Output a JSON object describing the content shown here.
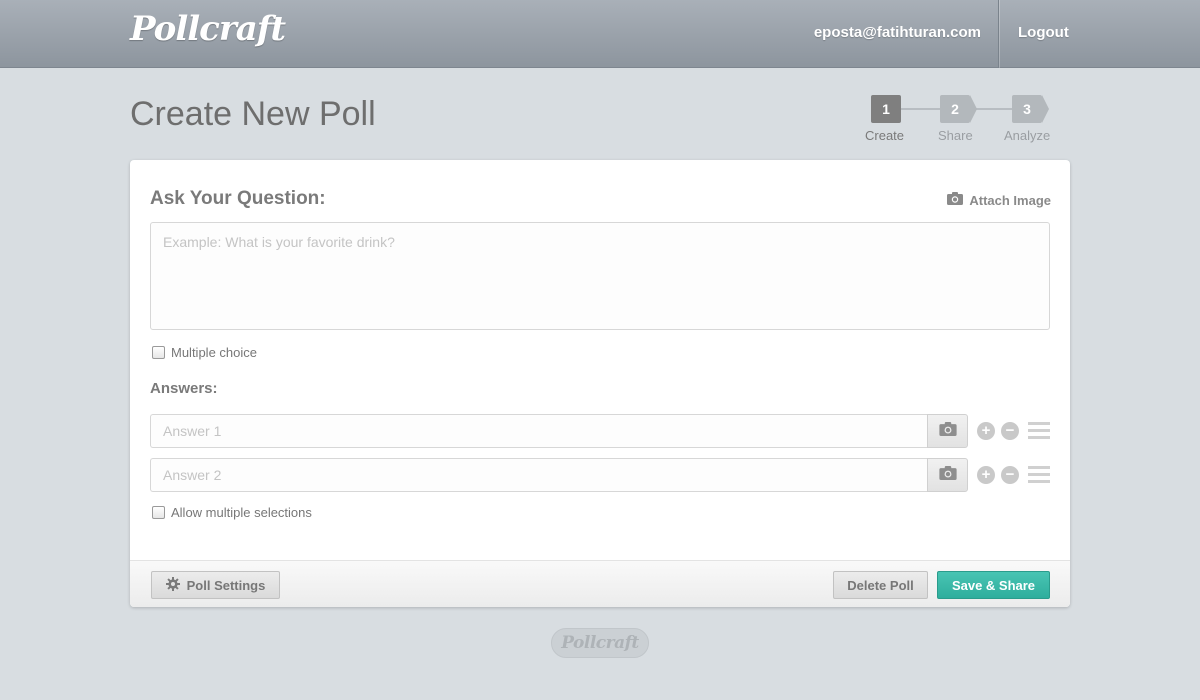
{
  "header": {
    "logo": "Pollcraft",
    "user_email": "eposta@fatihturan.com",
    "logout_label": "Logout"
  },
  "page_title": "Create New Poll",
  "steps": [
    {
      "number": "1",
      "label": "Create",
      "active": true
    },
    {
      "number": "2",
      "label": "Share",
      "active": false
    },
    {
      "number": "3",
      "label": "Analyze",
      "active": false
    }
  ],
  "form": {
    "question_label": "Ask Your Question:",
    "attach_image_label": "Attach Image",
    "question_placeholder": "Example: What is your favorite drink?",
    "multiple_choice_label": "Multiple choice",
    "answers_label": "Answers:",
    "answers": [
      {
        "placeholder": "Answer 1"
      },
      {
        "placeholder": "Answer 2"
      }
    ],
    "add_symbol": "+",
    "remove_symbol": "−",
    "allow_multiple_label": "Allow multiple selections"
  },
  "footer": {
    "poll_settings_label": "Poll Settings",
    "delete_label": "Delete Poll",
    "save_label": "Save & Share"
  },
  "bottom_logo": "Pollcraft",
  "colors": {
    "accent": "#37b5a4",
    "active_step": "#7f7f7f",
    "inactive_step": "#b3b8bc"
  },
  "icons": {
    "attach": "camera-icon",
    "answer_image": "camera-icon",
    "settings": "gear-icon",
    "reorder": "drag-handle-icon"
  }
}
